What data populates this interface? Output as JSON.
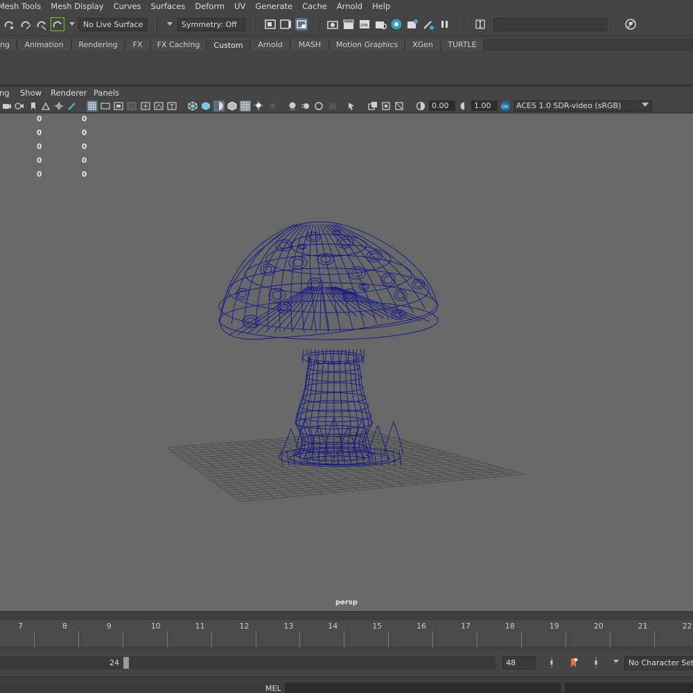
{
  "menubar": {
    "items": [
      "Mesh Tools",
      "Mesh Display",
      "Curves",
      "Surfaces",
      "Deform",
      "UV",
      "Generate",
      "Cache",
      "Arnold",
      "Help"
    ]
  },
  "status_line": {
    "live_surface": "No Live Surface",
    "symmetry": "Symmetry: Off"
  },
  "shelf": {
    "tabs": [
      "ng",
      "Animation",
      "Rendering",
      "FX",
      "FX Caching",
      "Custom",
      "Arnold",
      "MASH",
      "Motion Graphics",
      "XGen",
      "TURTLE"
    ],
    "active_tab": "Custom"
  },
  "panel_menu": {
    "items": [
      "ng",
      "Show",
      "Renderer",
      "Panels"
    ]
  },
  "panel_toolbar": {
    "exposure": "0.00",
    "gamma": "1.00",
    "color_space": "ACES 1.0 SDR-video (sRGB)"
  },
  "viewport": {
    "hud_rows": [
      [
        "0",
        "0"
      ],
      [
        "0",
        "0"
      ],
      [
        "0",
        "0"
      ],
      [
        "0",
        "0"
      ],
      [
        "0",
        "0"
      ]
    ],
    "camera": "persp",
    "wire_color": "#13168a",
    "grid_color": "#4a4a4a",
    "background": "#686868"
  },
  "timeline": {
    "frames": [
      "7",
      "8",
      "9",
      "10",
      "11",
      "12",
      "13",
      "14",
      "15",
      "16",
      "17",
      "18",
      "19",
      "20",
      "21",
      "22"
    ]
  },
  "range_slider": {
    "playback_end": "24",
    "animation_end": "48",
    "character_set": "No Character Set"
  },
  "command_line": {
    "language": "MEL"
  }
}
